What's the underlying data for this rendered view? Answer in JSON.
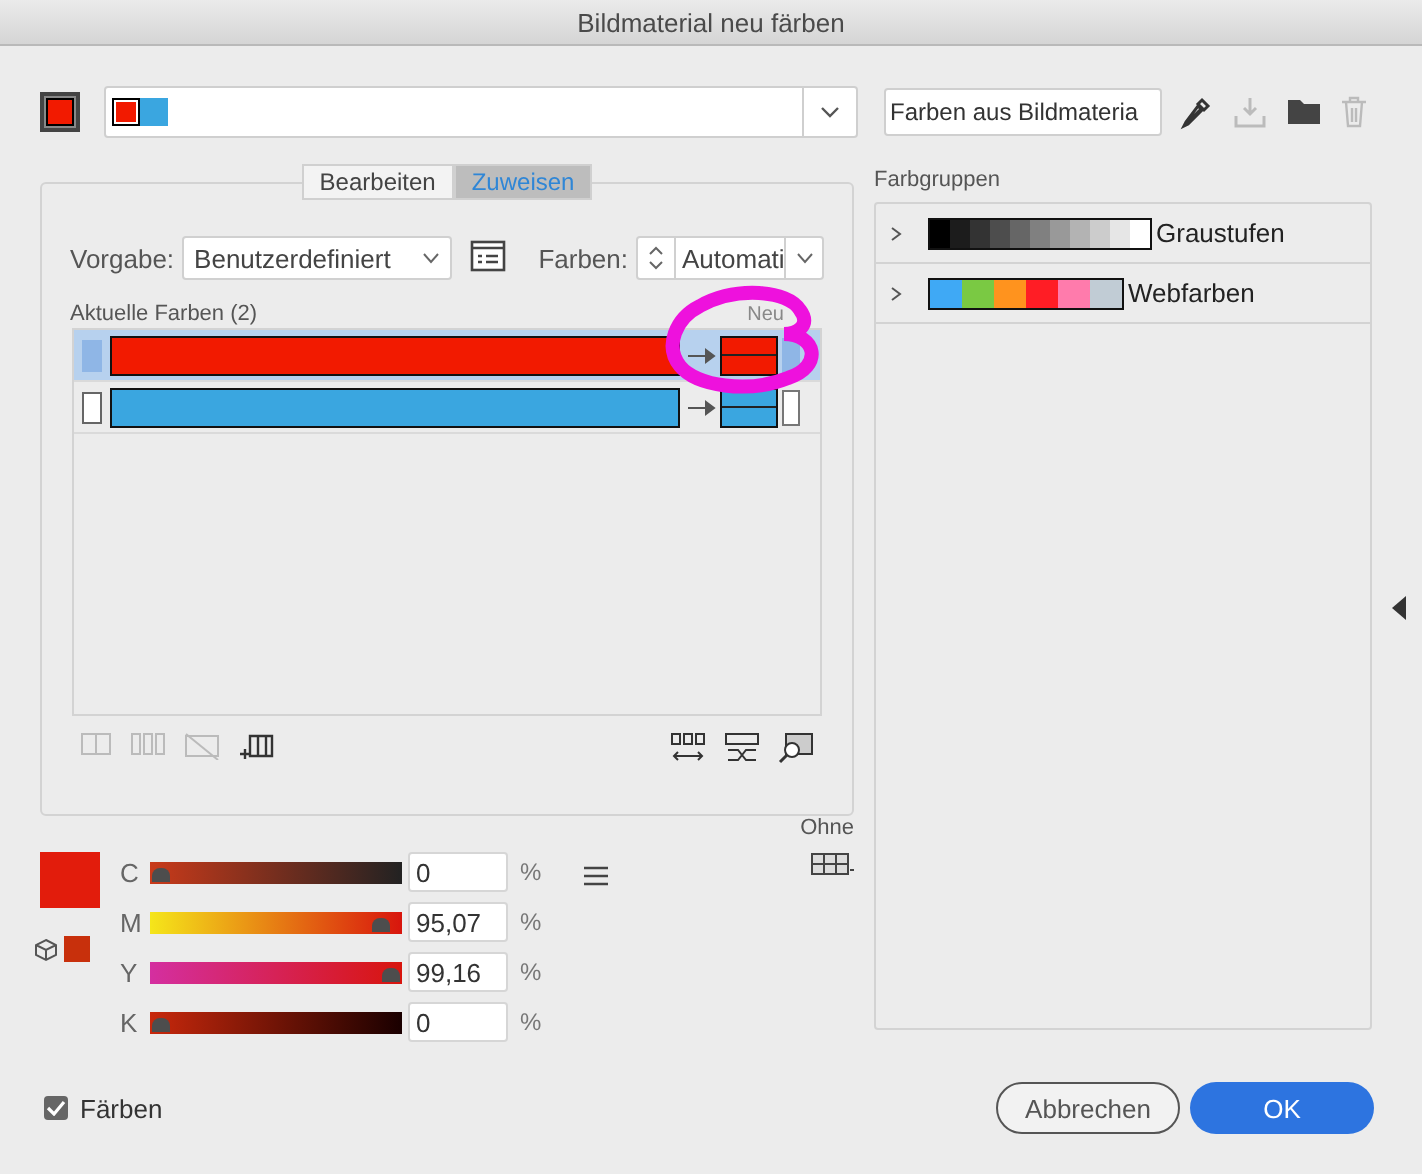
{
  "window": {
    "title": "Bildmaterial neu färben"
  },
  "toolbar": {
    "harmony_colors": [
      {
        "color": "#f21a00"
      },
      {
        "color": "#3aa6e0"
      }
    ],
    "name_field": {
      "value": "Farben aus Bildmateria"
    }
  },
  "tabs": [
    {
      "label": "Bearbeiten",
      "selected": false
    },
    {
      "label": "Zuweisen",
      "selected": true
    }
  ],
  "preset": {
    "label": "Vorgabe:",
    "value": "Benutzerdefiniert"
  },
  "colors_count": {
    "label": "Farben:",
    "value": "Automati"
  },
  "current_colors": {
    "label": "Aktuelle Farben (2)",
    "new_label": "Neu",
    "rows": [
      {
        "color": "#f21a00",
        "new": {
          "color": "#f21a00"
        },
        "selected": true
      },
      {
        "color": "#3aa6e0",
        "new": {
          "color": "#3aa6e0"
        },
        "selected": false
      }
    ]
  },
  "color_mode": {
    "current": {
      "color": "#e21c0c"
    },
    "gamut": {
      "color": "#c8300c"
    },
    "unit": "%",
    "channels": [
      {
        "name": "C",
        "value": "0",
        "level": 0
      },
      {
        "name": "M",
        "value": "95,07",
        "level": 0.9507
      },
      {
        "name": "Y",
        "value": "99,16",
        "level": 0.9916
      },
      {
        "name": "K",
        "value": "0",
        "level": 0
      }
    ]
  },
  "library": {
    "label": "Ohne"
  },
  "color_groups": {
    "label": "Farbgruppen",
    "groups": [
      {
        "name": "Graustufen",
        "expanded": false,
        "swatches": [
          {
            "color": "#000000"
          },
          {
            "color": "#1c1c1c"
          },
          {
            "color": "#333333"
          },
          {
            "color": "#4d4d4d"
          },
          {
            "color": "#666666"
          },
          {
            "color": "#808080"
          },
          {
            "color": "#999999"
          },
          {
            "color": "#b3b3b3"
          },
          {
            "color": "#cccccc"
          },
          {
            "color": "#e6e6e6"
          },
          {
            "color": "#ffffff"
          }
        ]
      },
      {
        "name": "Webfarben",
        "expanded": false,
        "swatches": [
          {
            "color": "#3fa9f5"
          },
          {
            "color": "#7ac943"
          },
          {
            "color": "#ff931e"
          },
          {
            "color": "#ff1d25"
          },
          {
            "color": "#ff7bac"
          },
          {
            "color": "#c1ccd5"
          }
        ]
      }
    ]
  },
  "recolor": {
    "label": "Färben",
    "checked": true
  },
  "buttons": [
    {
      "label": "Abbrechen",
      "kind": "secondary"
    },
    {
      "label": "OK",
      "kind": "primary"
    }
  ]
}
